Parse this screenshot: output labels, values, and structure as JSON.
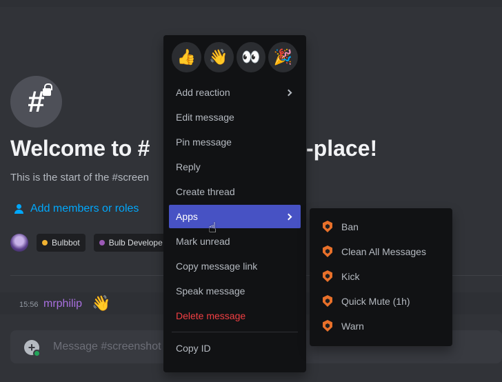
{
  "colors": {
    "accent": "#4752c4",
    "link": "#00a8fc",
    "danger": "#f23f43",
    "author": "#a970e0",
    "status_online": "#23a55a"
  },
  "welcome": {
    "title_left": "Welcome to #",
    "title_right": "-place!",
    "subtitle": "This is the start of the #screen",
    "add_members": "Add members or roles"
  },
  "roles": [
    {
      "label": "Bulbbot",
      "color": "#f0b232"
    },
    {
      "label": "Bulb Develope",
      "color": "#9b59b6"
    }
  ],
  "message": {
    "time": "15:56",
    "author": "mrphilip",
    "emoji": "👋"
  },
  "composer": {
    "placeholder": "Message #screenshot"
  },
  "context_menu": {
    "quick_reactions": [
      "👍",
      "👋",
      "👀",
      "🎉"
    ],
    "items": {
      "add_reaction": "Add reaction",
      "edit_message": "Edit message",
      "pin_message": "Pin message",
      "reply": "Reply",
      "create_thread": "Create thread",
      "apps": "Apps",
      "mark_unread": "Mark unread",
      "copy_message_link": "Copy message link",
      "speak_message": "Speak message",
      "delete_message": "Delete message",
      "copy_id": "Copy ID"
    }
  },
  "apps_submenu": {
    "items": [
      "Ban",
      "Clean All Messages",
      "Kick",
      "Quick Mute (1h)",
      "Warn"
    ]
  }
}
